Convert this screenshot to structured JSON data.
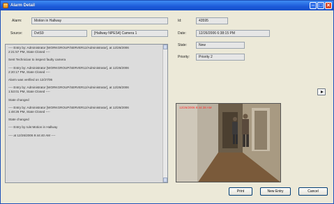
{
  "window": {
    "title": "Alarm Detail"
  },
  "details": {
    "alarm_label": "Alarm:",
    "alarm_value": "Motion in Hallway",
    "source_label": "Source:",
    "source_value": "DvtS9",
    "camera_value": "[Hallway NPES4] Camera 1",
    "id_label": "Id:",
    "id_value": "43595",
    "date_label": "Date:",
    "date_value": "12/26/2006 6:38:15 PM",
    "state_label": "State:",
    "state_value": "New",
    "priority_label": "Priority:",
    "priority_value": "Priority 2"
  },
  "log": {
    "lines": [
      "---- Entry by: Administrator [WORKGROUP/SERVER12/Administrator], at 12/26/2006",
      "2:21:57 PM, State Closed ----",
      "",
      "Sent Technician to inspect faulty camera",
      "",
      "---- Entry by: Administrator [WORKGROUP/SERVER12/Administrator], at 12/26/2006",
      "2:20:17 PM, State Closed ----",
      "",
      "Alarm was verified on 12/27/06",
      "",
      "---- Entry by: Administrator [WORKGROUP/SERVER12/Administrator], at 12/26/2006",
      "1:53:01 PM, State Closed ----",
      "",
      "State changed",
      "",
      "---- Entry by: Administrator [WORKGROUP/SERVER12/Administrator], at 12/26/2006",
      "1:48:26 PM, State Closed ----",
      "",
      "State changed",
      "",
      "---- Entry by rule:Motion in Hallway",
      "",
      "---- at 12/26/2006 9:44:40 AM ----"
    ]
  },
  "buttons": {
    "print": "Print",
    "new_entry": "New Entry",
    "cancel": "Cancel"
  },
  "video": {
    "timestamp": "12/26/2006 9:44:38 AM"
  }
}
